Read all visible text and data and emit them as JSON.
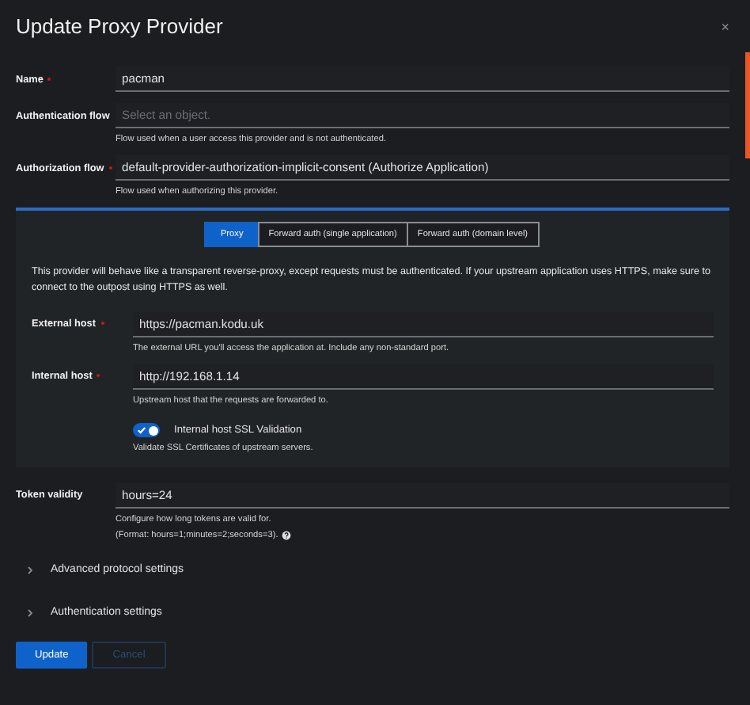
{
  "modal": {
    "title": "Update Proxy Provider",
    "close": "×"
  },
  "fields": [
    {
      "label": "Name",
      "required": true,
      "value": "pacman"
    },
    {
      "label": "Authentication flow",
      "required": false,
      "placeholder": "Select an object.",
      "help": "Flow used when a user access this provider and is not authenticated."
    },
    {
      "label": "Authorization flow",
      "required": true,
      "value": "default-provider-authorization-implicit-consent (Authorize Application)",
      "help": "Flow used when authorizing this provider."
    }
  ],
  "mode_tabs": [
    {
      "label": "Proxy",
      "selected": true
    },
    {
      "label": "Forward auth (single application)",
      "selected": false
    },
    {
      "label": "Forward auth (domain level)",
      "selected": false
    }
  ],
  "mode_description": "This provider will behave like a transparent reverse-proxy, except requests must be authenticated. If your upstream application uses HTTPS, make sure to connect to the outpost using HTTPS as well.",
  "host_fields": [
    {
      "label": "External host",
      "required": true,
      "value": "https://pacman.kodu.uk",
      "help": "The external URL you'll access the application at. Include any non-standard port."
    },
    {
      "label": "Internal host",
      "required": true,
      "value": "http://192.168.1.14",
      "help": "Upstream host that the requests are forwarded to."
    }
  ],
  "ssl_validation": {
    "label": "Internal host SSL Validation",
    "on": true,
    "help": "Validate SSL Certificates of upstream servers."
  },
  "token_validity": {
    "label": "Token validity",
    "value": "hours=24",
    "help": [
      "Configure how long tokens are valid for.",
      "(Format: hours=1;minutes=2;seconds=3)."
    ]
  },
  "sections": [
    {
      "label": "Advanced protocol settings",
      "expanded": false
    },
    {
      "label": "Authentication settings",
      "expanded": false
    }
  ],
  "buttons": [
    {
      "label": "Update",
      "kind": "primary"
    },
    {
      "label": "Cancel",
      "kind": "secondary"
    }
  ]
}
